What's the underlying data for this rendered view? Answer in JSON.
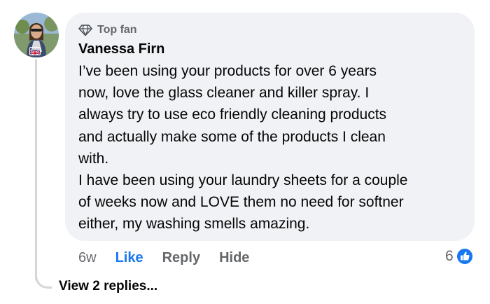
{
  "comment": {
    "badge": {
      "icon": "diamond-icon",
      "label": "Top fan"
    },
    "author": "Vanessa Firn",
    "avatar": {
      "badge_icon": "uk-flag-icon"
    },
    "body_lines": [
      "I’ve been using your products for over 6 years",
      "now, love the glass cleaner and killer spray. I",
      "always try to use eco friendly cleaning products",
      "and actually make some of the products I clean",
      "with.",
      "I have been using your laundry sheets for a couple",
      "of weeks now and LOVE them no need for softner",
      "either, my washing smells amazing."
    ],
    "actions": {
      "time": "6w",
      "like": "Like",
      "reply": "Reply",
      "hide": "Hide"
    },
    "reactions": {
      "count": "6",
      "icon": "thumbs-up-icon"
    }
  },
  "view_replies": "View 2 replies...",
  "colors": {
    "bubble": "#f0f2f5",
    "like_blue": "#1877f2",
    "secondary_text": "#65676b",
    "primary_text": "#050505"
  }
}
